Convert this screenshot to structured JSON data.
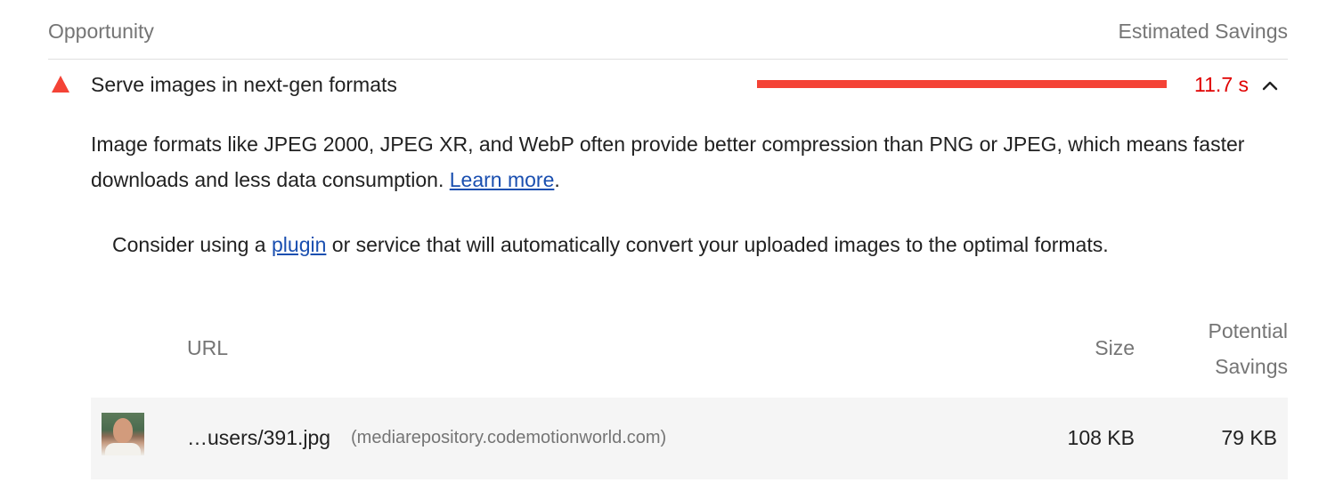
{
  "header": {
    "opportunity_label": "Opportunity",
    "savings_label": "Estimated Savings"
  },
  "audit": {
    "status_icon": "fail-triangle-icon",
    "status_color": "#f44336",
    "title": "Serve images in next-gen formats",
    "savings_value": "11.7 s",
    "savings_bar_fraction": 1.0,
    "expand_icon": "chevron-up-icon"
  },
  "description": {
    "text": "Image formats like JPEG 2000, JPEG XR, and WebP often provide better compression than PNG or JPEG, which means faster downloads and less data consumption.",
    "link_text": "Learn more",
    "trailing": "."
  },
  "stack_pack": {
    "prefix": "Consider using a",
    "link_text": "plugin",
    "suffix": "or service that will automatically convert your uploaded images to the optimal formats."
  },
  "table": {
    "headers": {
      "url": "URL",
      "size": "Size",
      "savings_line1": "Potential",
      "savings_line2": "Savings"
    },
    "rows": [
      {
        "thumbnail": "user-photo-thumbnail",
        "url": "…users/391.jpg",
        "host": "(mediarepository.codemotionworld.com)",
        "size": "108 KB",
        "savings": "79 KB"
      }
    ]
  }
}
